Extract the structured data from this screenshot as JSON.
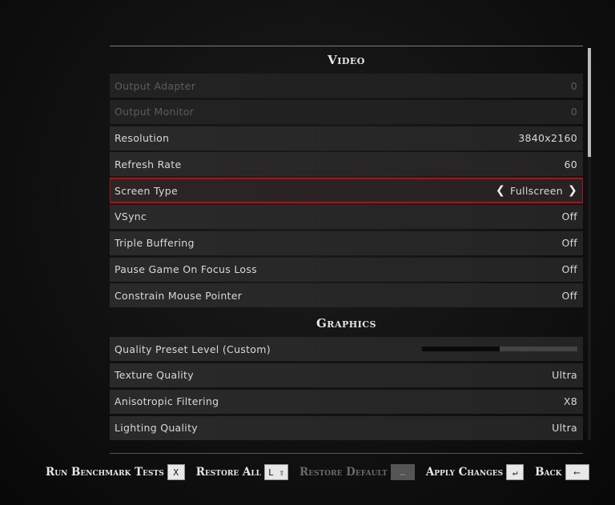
{
  "video": {
    "title": "Video",
    "rows": [
      {
        "label": "Output Adapter",
        "value": "0",
        "disabled": true
      },
      {
        "label": "Output Monitor",
        "value": "0",
        "disabled": true
      },
      {
        "label": "Resolution",
        "value": "3840x2160"
      },
      {
        "label": "Refresh Rate",
        "value": "60"
      },
      {
        "label": "Screen Type",
        "value": "Fullscreen",
        "selected": true
      },
      {
        "label": "VSync",
        "value": "Off"
      },
      {
        "label": "Triple Buffering",
        "value": "Off"
      },
      {
        "label": "Pause Game On Focus Loss",
        "value": "Off"
      },
      {
        "label": "Constrain Mouse Pointer",
        "value": "Off"
      }
    ]
  },
  "graphics": {
    "title": "Graphics",
    "quality_preset": {
      "label": "Quality Preset Level (Custom)",
      "level_fraction": 0.5
    },
    "rows": [
      {
        "label": "Texture Quality",
        "value": "Ultra"
      },
      {
        "label": "Anisotropic Filtering",
        "value": "X8"
      },
      {
        "label": "Lighting Quality",
        "value": "Ultra"
      }
    ]
  },
  "footer": {
    "benchmark": {
      "label": "Run Benchmark Tests",
      "key": "X"
    },
    "restore_all": {
      "label": "Restore All",
      "key": "L ⇧"
    },
    "restore_default": {
      "label": "Restore Default",
      "key": "…"
    },
    "apply": {
      "label": "Apply Changes",
      "key": "↵"
    },
    "back": {
      "label": "Back",
      "key": "⟵"
    }
  },
  "icons": {
    "left": "chevron-left-icon",
    "right": "chevron-right-icon"
  },
  "colors": {
    "selection": "#a5141a"
  }
}
